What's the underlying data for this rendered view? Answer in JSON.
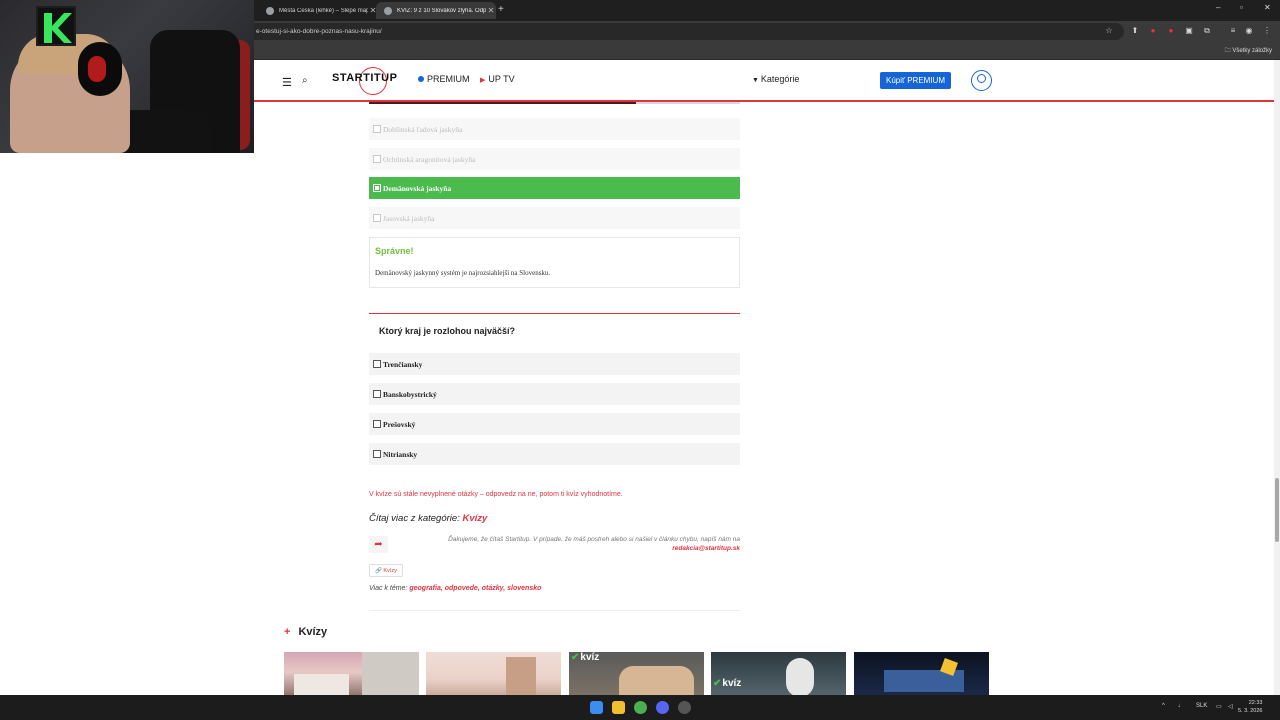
{
  "browser": {
    "tabs": [
      {
        "title": "Města Česka (lehké) – Slepé mapy",
        "active": false
      },
      {
        "title": "KVÍZ: 9 z 10 Slovákov zlyhá. Odp",
        "active": true
      }
    ],
    "new_tab": "+",
    "address": "e-otestuj-si-ako-dobre-poznas-nasu-krajinu/",
    "bookmarks_all": "Všetky záložky",
    "window_controls": {
      "minimize": "–",
      "restore": "▫",
      "close": "✕"
    }
  },
  "site_header": {
    "logo": "STARTITUP",
    "premium_label": "PREMIUM",
    "uptv_label": "UP TV",
    "categories_label": "Kategórie",
    "buy_premium_label": "Kúpiť PREMIUM",
    "colors": {
      "accent": "#e2343f",
      "brand_blue": "#1565d8",
      "correct_green": "#4cbb4d"
    }
  },
  "quiz": {
    "prev_options": [
      {
        "label": "Dobšinská ľadová jaskyňa",
        "state": "dim"
      },
      {
        "label": "Ochtinská aragonitová jaskyňa",
        "state": "dim"
      },
      {
        "label": "Demänovská jaskyňa",
        "state": "correct"
      },
      {
        "label": "Jasovská jaskyňa",
        "state": "dim"
      }
    ],
    "verdict": "Správne!",
    "explanation": "Demänovský jaskynný systém je najrozsiahlejší na Slovensku.",
    "question": "Ktorý kraj je rozlohou najväčší?",
    "options": [
      {
        "label": "Trenčiansky"
      },
      {
        "label": "Banskobystrický"
      },
      {
        "label": "Prešovský"
      },
      {
        "label": "Nitriansky"
      }
    ],
    "warning": "V kvíze sú stále nevyplnené otázky – odpovedz na ne, potom ti kvíz vyhodnotíme."
  },
  "article_footer": {
    "more_prefix": "Čítaj viac z kategórie: ",
    "more_category": "Kvízy",
    "thanks_text": "Ďakujeme, že čítaš Startitup. V prípade, že máš postreh alebo si našiel v článku chybu, napíš nám na",
    "thanks_email": "redakcia@startitup.sk",
    "tag_chip": "Kvízy",
    "topics_prefix": "Viac k téme: ",
    "topics": [
      "geografia,",
      "odpovede,",
      "otázky,",
      "slovensko"
    ]
  },
  "related": {
    "section_title": "Kvízy",
    "thumb_badges": [
      "kvíz",
      "kvíz"
    ]
  },
  "taskbar": {
    "language": "SLK",
    "time": "22:33",
    "date": "5. 3. 2026"
  }
}
